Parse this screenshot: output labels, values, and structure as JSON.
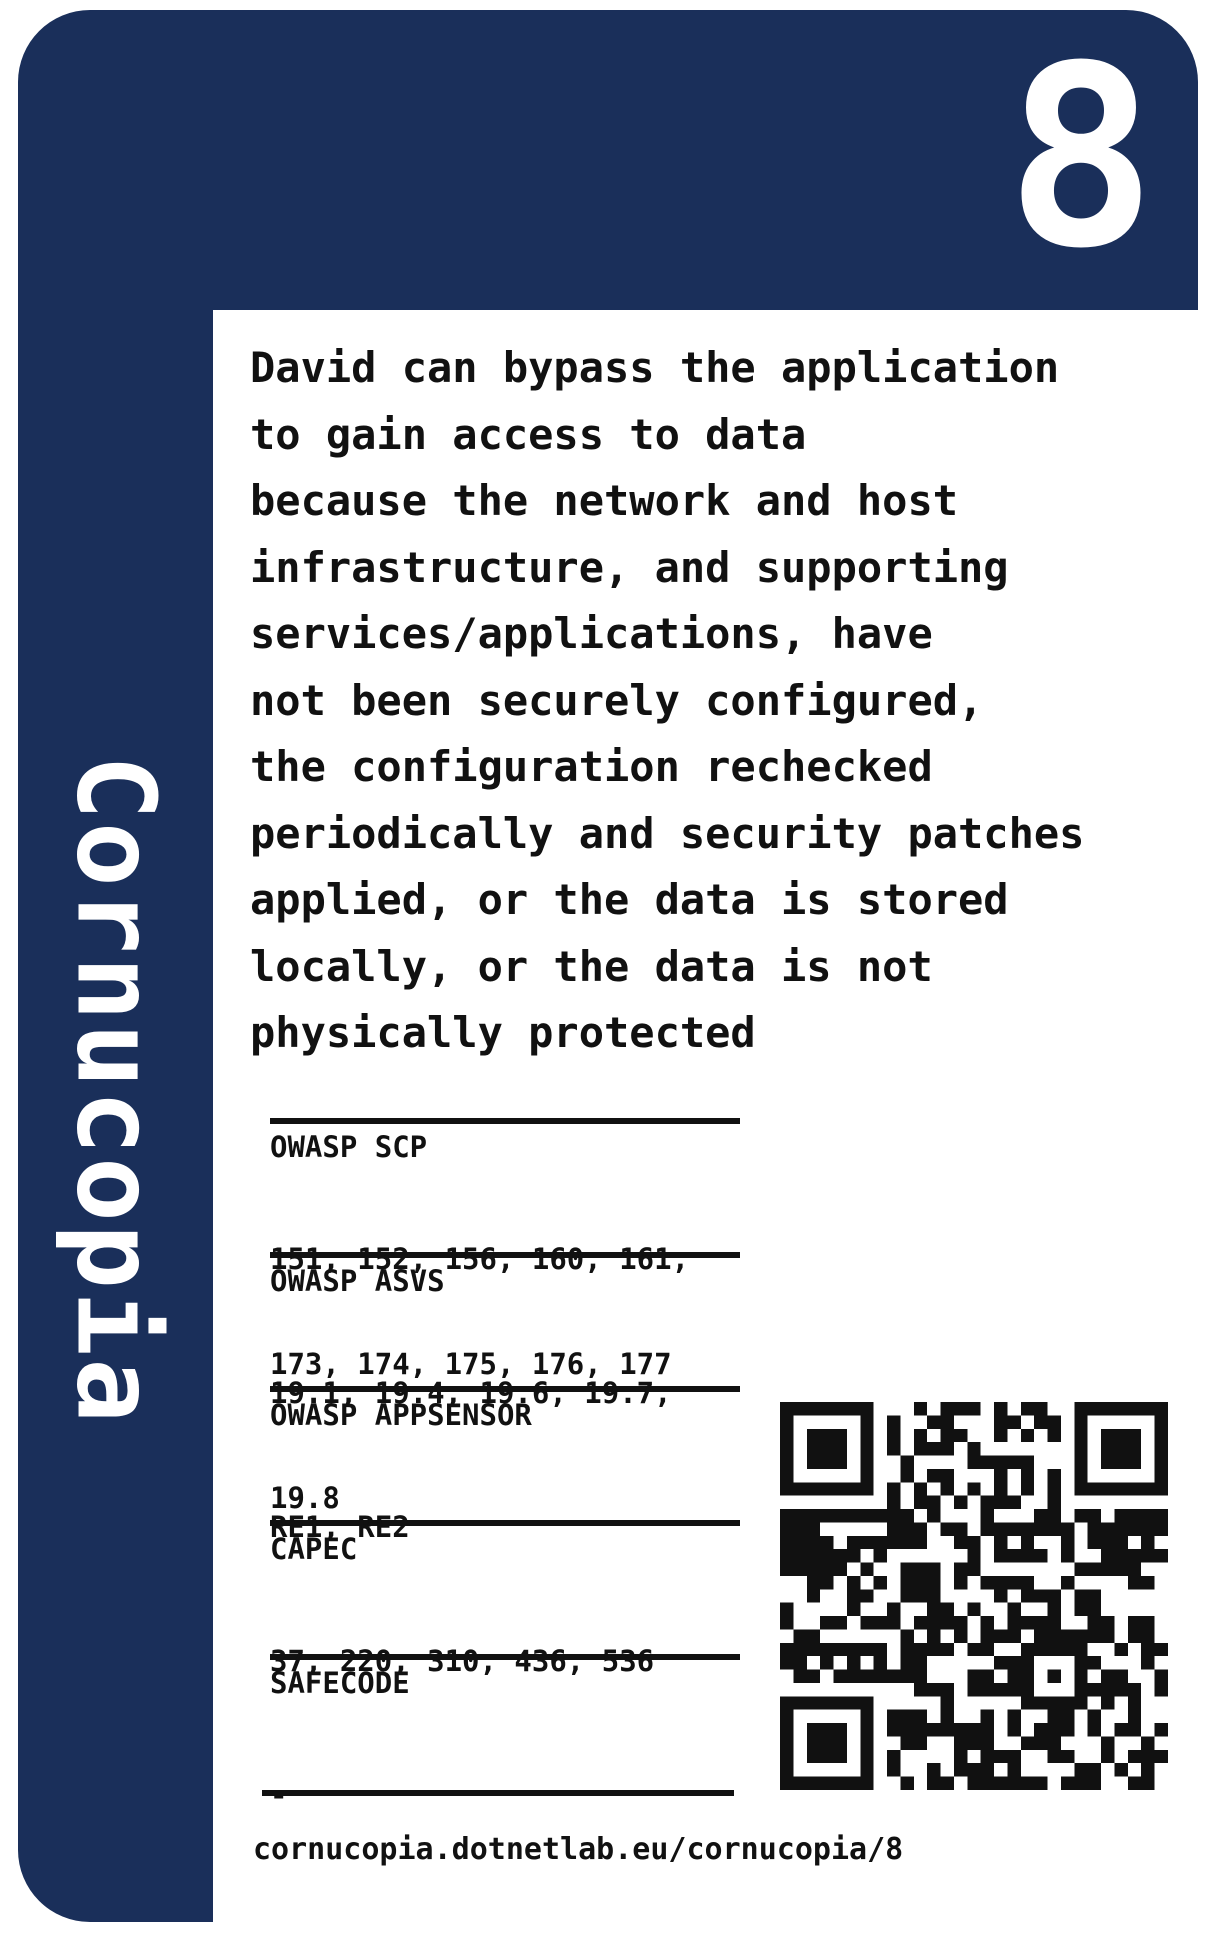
{
  "card": {
    "number": "8",
    "brand": "Cornucopia",
    "colors": {
      "frame": "#1a2f5a",
      "background": "#ffffff",
      "text": "#111111"
    },
    "description_lines": [
      "David can bypass the application",
      "to gain access to data",
      "because the network and host",
      "infrastructure, and supporting",
      "services/applications, have",
      "not been securely configured,",
      "the configuration rechecked",
      "periodically and security patches",
      "applied, or the data is stored",
      "locally, or the data is not",
      "physically protected"
    ],
    "references": [
      {
        "title": "OWASP SCP",
        "values": [
          "151, 152, 156, 160, 161,",
          "173, 174, 175, 176, 177"
        ]
      },
      {
        "title": "OWASP ASVS",
        "values": [
          "19.1, 19.4, 19.6, 19.7,",
          "19.8"
        ]
      },
      {
        "title": "OWASP APPSENSOR",
        "values": [
          "RE1, RE2"
        ]
      },
      {
        "title": "CAPEC",
        "values": [
          "37, 220, 310, 436, 536"
        ]
      },
      {
        "title": "SAFECODE",
        "values": [
          "-"
        ]
      }
    ],
    "qr_icon": "qr-code-icon",
    "url": "cornucopia.dotnetlab.eu/cornucopia/8"
  }
}
